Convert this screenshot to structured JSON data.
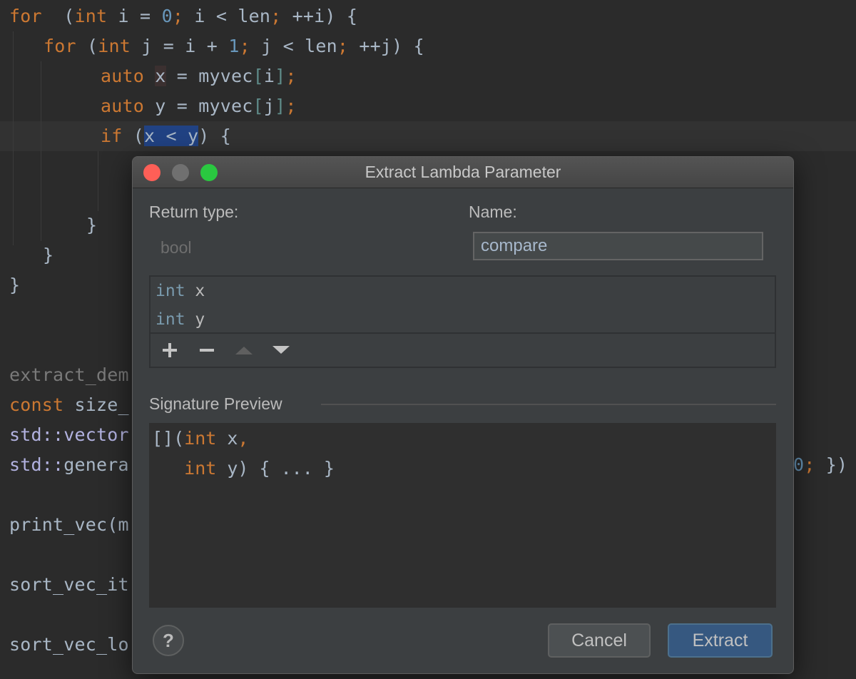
{
  "editor": {
    "lines": [
      {
        "tokens": [
          [
            "kw",
            "for"
          ],
          [
            "",
            "  ("
          ],
          [
            "kw",
            "int"
          ],
          [
            "",
            " i = "
          ],
          [
            "num",
            "0"
          ],
          [
            "kw",
            ";"
          ],
          [
            "",
            " i < len"
          ],
          [
            "kw",
            ";"
          ],
          [
            "",
            " ++i) {"
          ]
        ]
      },
      {
        "tokens": [
          [
            "kw",
            "for"
          ],
          [
            "",
            " ("
          ],
          [
            "kw",
            "int"
          ],
          [
            "",
            " j = i + "
          ],
          [
            "num",
            "1"
          ],
          [
            "kw",
            ";"
          ],
          [
            "",
            " j < len"
          ],
          [
            "kw",
            ";"
          ],
          [
            "",
            " ++j) {"
          ]
        ]
      },
      {
        "tokens": [
          [
            "kw",
            "auto"
          ],
          [
            "",
            " "
          ],
          [
            "hl-x",
            "x"
          ],
          [
            "",
            " = myvec"
          ],
          [
            "br",
            "["
          ],
          [
            "",
            "i"
          ],
          [
            "br",
            "]"
          ],
          [
            "kw",
            ";"
          ]
        ]
      },
      {
        "tokens": [
          [
            "kw",
            "auto"
          ],
          [
            "",
            " y = myvec"
          ],
          [
            "br",
            "["
          ],
          [
            "",
            "j"
          ],
          [
            "br",
            "]"
          ],
          [
            "kw",
            ";"
          ]
        ]
      },
      {
        "tokens": [
          [
            "kw",
            "if"
          ],
          [
            "",
            " ("
          ],
          [
            "sel",
            "x < y"
          ],
          [
            "",
            ") {"
          ]
        ]
      },
      {
        "tokens": [
          [
            "",
            "}"
          ]
        ]
      },
      {
        "tokens": [
          [
            "",
            "}"
          ]
        ]
      },
      {
        "tokens": [
          [
            "",
            "}"
          ]
        ]
      },
      {
        "tokens": [
          [
            "dim",
            "extract_dem"
          ]
        ]
      },
      {
        "tokens": [
          [
            "kw",
            "const"
          ],
          [
            "",
            " size_"
          ]
        ]
      },
      {
        "tokens": [
          [
            "std",
            "std::vector"
          ]
        ]
      },
      {
        "tokens": [
          [
            "std",
            "std::"
          ],
          [
            "",
            "genera"
          ]
        ]
      },
      {
        "tokens": [
          [
            "",
            "print_vec(m"
          ]
        ]
      },
      {
        "tokens": [
          [
            "",
            "sort_vec_it"
          ]
        ]
      },
      {
        "tokens": [
          [
            "",
            "sort_vec_lo"
          ]
        ]
      }
    ],
    "right_fragment": {
      "tokens": [
        [
          "num",
          "0"
        ],
        [
          "kw",
          ";"
        ],
        [
          "",
          " })"
        ]
      ]
    }
  },
  "dialog": {
    "title": "Extract Lambda Parameter",
    "return_type_label": "Return type:",
    "return_type_value": "bool",
    "name_label": "Name:",
    "name_value": "compare",
    "parameters": [
      {
        "type": "int",
        "name": "x"
      },
      {
        "type": "int",
        "name": "y"
      }
    ],
    "toolbar": {
      "add": "+",
      "remove": "−",
      "move_up": "▲",
      "move_down": "▼"
    },
    "signature_label": "Signature Preview",
    "signature_lines": [
      {
        "tokens": [
          [
            "",
            "[]("
          ],
          [
            "kw",
            "int"
          ],
          [
            "",
            " x"
          ],
          [
            "kw",
            ","
          ]
        ]
      },
      {
        "tokens": [
          [
            "",
            "   "
          ],
          [
            "kw",
            "int"
          ],
          [
            "",
            " y) { ... }"
          ]
        ]
      }
    ],
    "help_label": "?",
    "cancel_label": "Cancel",
    "extract_label": "Extract"
  }
}
